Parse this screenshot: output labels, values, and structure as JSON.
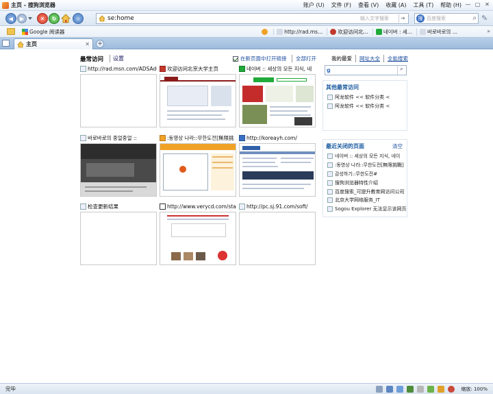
{
  "window": {
    "title": "主页 - 搜狗浏览器",
    "menu": [
      "账户 (U)",
      "文件 (F)",
      "查看 (V)",
      "收藏 (A)",
      "工具 (T)",
      "帮助 (H)"
    ],
    "controls": [
      "—",
      "▢",
      "✕"
    ]
  },
  "toolbar": {
    "address_value": "se:home",
    "address_hint": "输入文字搜索",
    "search_placeholder": "百度搜索"
  },
  "bookmarks": {
    "left_item": "Google 阅读器",
    "right_items": [
      "http://rad.ms...",
      "欢迎访问北...",
      "네이버 : 세...",
      "바로바로의 ..."
    ]
  },
  "tabs": [
    {
      "label": "主页"
    }
  ],
  "home": {
    "section_title": "最常访问",
    "settings_label": "设置",
    "open_in_new_label": "在新页面中打开链接",
    "open_all_label": "全部打开",
    "thumbnails": [
      {
        "caption": "http://rad.msn.com/ADSAdC"
      },
      {
        "caption": "欢迎访问北京大学主页"
      },
      {
        "caption": "네이버 :: 세상의 모든 지식, 네"
      },
      {
        "caption": "바로바로의 중얼중얼 ::"
      },
      {
        "caption": ":동영상 나라::무한도전[無限挑"
      },
      {
        "caption": "http://koreayh.com/"
      },
      {
        "caption": "检查更新结果"
      },
      {
        "caption": "http://www.verycd.com/sta"
      },
      {
        "caption": "http://pc.sj.91.com/soft/"
      }
    ]
  },
  "sidebar": {
    "links": [
      "我的最爱",
      "网址大全",
      "全能搜索"
    ],
    "google_letter": "g",
    "other_title": "其他最常访问",
    "other_items": [
      "阿龙软件 << 软件分类 <",
      "阿龙软件 << 软件分类 <"
    ],
    "recent_title": "最近关闭的页面",
    "recent_clear": "清空",
    "recent_items": [
      "네이버 :: 세상의 모든 지식, 네이",
      ":동영상 나라::무한도전[無限挑戰]",
      "감성하기::무한도전#",
      "搜狗浏览器特性介绍",
      "百度搜索_可提升教育网访问公司",
      "北京大学网络服务_IT",
      "Sogou Explorer 无法显示该网页"
    ]
  },
  "status": {
    "text": "完毕",
    "zoom": "缩放: 100%"
  }
}
